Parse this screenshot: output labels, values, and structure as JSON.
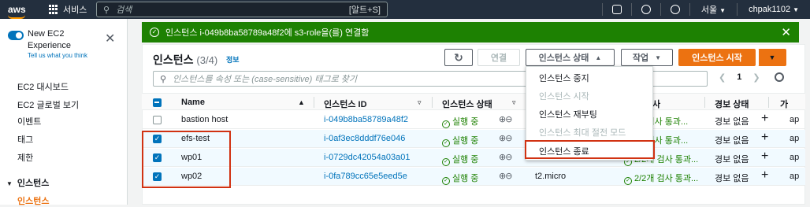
{
  "topbar": {
    "logo": "aws",
    "services": "서비스",
    "search_placeholder": "검색",
    "search_shortcut": "[알트+S]",
    "region": "서울",
    "user": "chpak1102"
  },
  "sidebar": {
    "toggle_label": "New EC2 Experience",
    "toggle_sub": "Tell us what you think",
    "items": [
      "EC2 대시보드",
      "EC2 글로벌 보기",
      "이벤트",
      "태그",
      "제한"
    ],
    "section": "인스턴스",
    "active_item": "인스턴스"
  },
  "flash": {
    "message": "인스턴스 i-049b8ba58789a48f2에 s3-role을(를) 연결함"
  },
  "panel": {
    "title": "인스턴스",
    "count": "(3/4)",
    "info": "정보",
    "connect": "연결",
    "state_btn": "인스턴스 상태",
    "actions_btn": "작업",
    "launch_btn": "인스턴스 시작",
    "filter_placeholder": "인스턴스를 속성 또는 (case-sensitive) 태그로 찾기",
    "page": "1"
  },
  "table": {
    "headers": {
      "name": "Name",
      "id": "인스턴스 ID",
      "state": "인스턴스 상태",
      "check": "사",
      "alarm": "경보 상태",
      "az": "가"
    },
    "rows": [
      {
        "name": "bastion host",
        "id": "i-049b8ba58789a48f2",
        "state": "실행 중",
        "type": "",
        "check": "2/2개 검사 통과...",
        "alarm": "경보 없음",
        "az": "ap"
      },
      {
        "name": "efs-test",
        "id": "i-0af3ec8dddf76e046",
        "state": "실행 중",
        "type": "",
        "check": "2/2개 검사 통과...",
        "alarm": "경보 없음",
        "az": "ap"
      },
      {
        "name": "wp01",
        "id": "i-0729dc42054a03a01",
        "state": "실행 중",
        "type": "t2.micro",
        "check": "2/2개 검사 통과...",
        "alarm": "경보 없음",
        "az": "ap"
      },
      {
        "name": "wp02",
        "id": "i-0fa789cc65e5eed5e",
        "state": "실행 중",
        "type": "t2.micro",
        "check": "2/2개 검사 통과...",
        "alarm": "경보 없음",
        "az": "ap"
      }
    ]
  },
  "menu": {
    "items": [
      "인스턴스 중지",
      "인스턴스 시작",
      "인스턴스 재부팅",
      "인스턴스 최대 절전 모드",
      "인스턴스 종료"
    ]
  },
  "colors": {
    "accent": "#ec7211",
    "success": "#1d8102",
    "highlight": "#d13212",
    "link": "#0073bb"
  }
}
